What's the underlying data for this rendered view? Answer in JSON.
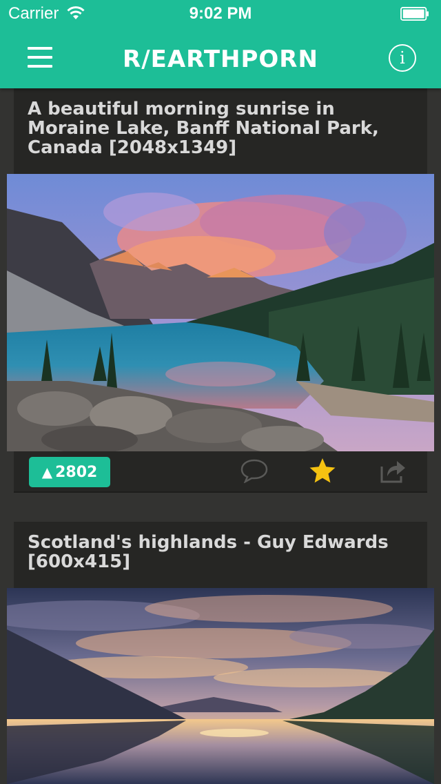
{
  "status_bar": {
    "carrier": "Carrier",
    "time": "9:02 PM"
  },
  "nav": {
    "title": "R/EARTHPORN",
    "info_glyph": "i",
    "menu_icon": "hamburger-menu-icon",
    "info_icon": "info-circle-icon"
  },
  "posts": [
    {
      "title": "A beautiful morning sunrise in Moraine Lake, Banff National Park, Canada [2048x1349]",
      "score": "2802",
      "starred": true
    },
    {
      "title": "Scotland's highlands - Guy Edwards [600x415]"
    }
  ],
  "colors": {
    "accent": "#1dbe97",
    "background": "#333331",
    "card": "#262624",
    "star": "#f5c211",
    "icon_muted": "#5a5a58"
  }
}
